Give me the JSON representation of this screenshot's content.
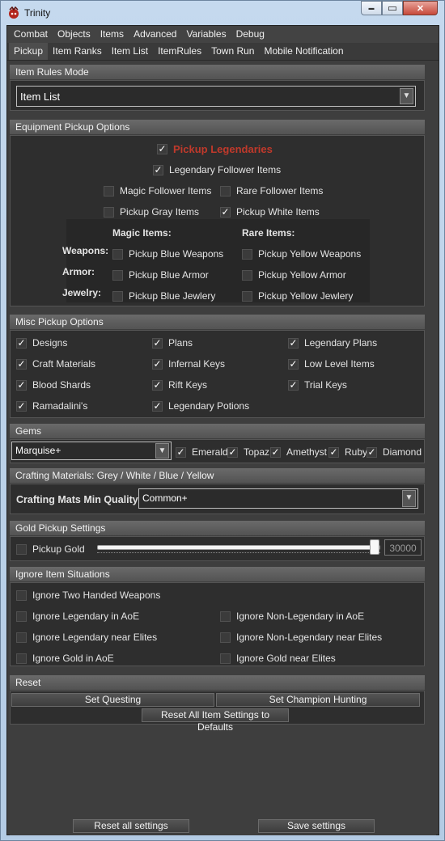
{
  "window": {
    "title": "Trinity",
    "minimize_glyph": "▬",
    "maximize_glyph": "▭",
    "close_glyph": "✕"
  },
  "menubar": {
    "items": [
      "Combat",
      "Objects",
      "Items",
      "Advanced",
      "Variables",
      "Debug"
    ]
  },
  "tabs": {
    "items": [
      "Pickup",
      "Item Ranks",
      "Item List",
      "ItemRules",
      "Town Run",
      "Mobile Notification"
    ],
    "active": "Pickup"
  },
  "check_glyph": "✓",
  "dropdown_arrow": "▼",
  "item_rules_mode": {
    "header": "Item Rules Mode",
    "selected": "Item List"
  },
  "equipment": {
    "header": "Equipment Pickup Options",
    "pickup_legendaries": "Pickup Legendaries",
    "legendary_follower": "Legendary Follower Items",
    "magic_follower": "Magic Follower Items",
    "rare_follower": "Rare Follower Items",
    "pickup_gray": "Pickup Gray Items",
    "pickup_white": "Pickup White Items",
    "magic_items_heading": "Magic Items:",
    "rare_items_heading": "Rare Items:",
    "weapons_label": "Weapons:",
    "armor_label": "Armor:",
    "jewelry_label": "Jewelry:",
    "blue_weapons": "Pickup Blue Weapons",
    "yellow_weapons": "Pickup Yellow Weapons",
    "blue_armor": "Pickup Blue Armor",
    "yellow_armor": "Pickup Yellow Armor",
    "blue_jewelry": "Pickup Blue Jewlery",
    "yellow_jewelry": "Pickup Yellow Jewlery"
  },
  "misc": {
    "header": "Misc Pickup Options",
    "designs": "Designs",
    "plans": "Plans",
    "legendary_plans": "Legendary Plans",
    "craft_materials": "Craft Materials",
    "infernal_keys": "Infernal Keys",
    "low_level_items": "Low Level Items",
    "blood_shards": "Blood Shards",
    "rift_keys": "Rift Keys",
    "trial_keys": "Trial Keys",
    "ramadalinis": "Ramadalini's",
    "legendary_potions": "Legendary Potions"
  },
  "gems": {
    "header": "Gems",
    "quality": "Marquise+",
    "emerald": "Emerald",
    "topaz": "Topaz",
    "amethyst": "Amethyst",
    "ruby": "Ruby",
    "diamond": "Diamond"
  },
  "crafting": {
    "header": "Crafting Materials: Grey / White / Blue / Yellow",
    "label": "Crafting Mats Min Quality:",
    "selected": "Common+"
  },
  "gold": {
    "header": "Gold Pickup Settings",
    "pickup_gold": "Pickup Gold",
    "amount": "30000",
    "slider_fraction": 0.98
  },
  "ignore": {
    "header": "Ignore Item Situations",
    "two_handed": "Ignore Two Handed Weapons",
    "legendary_aoe": "Ignore Legendary in AoE",
    "non_legendary_aoe": "Ignore Non-Legendary in AoE",
    "legendary_elites": "Ignore Legendary near Elites",
    "non_legendary_elites": "Ignore Non-Legendary near Elites",
    "gold_aoe": "Ignore Gold in AoE",
    "gold_elites": "Ignore Gold near Elites"
  },
  "reset": {
    "header": "Reset",
    "set_questing": "Set Questing",
    "set_champion": "Set Champion Hunting",
    "reset_all_items": "Reset All Item Settings to Defaults"
  },
  "footer": {
    "reset_all": "Reset all settings",
    "save": "Save settings"
  }
}
